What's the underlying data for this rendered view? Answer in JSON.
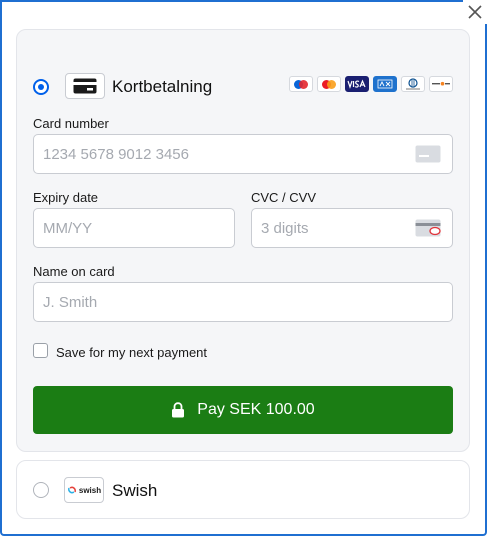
{
  "dialog": {
    "close_icon": "close-icon"
  },
  "card_method": {
    "title": "Kortbetalning",
    "selected": true,
    "icon": "credit-card-icon",
    "brands": [
      "Maestro",
      "Mastercard",
      "VISA",
      "American Express",
      "Diners Club",
      "Discover"
    ]
  },
  "form": {
    "card_number": {
      "label": "Card number",
      "placeholder": "1234 5678 9012 3456"
    },
    "expiry": {
      "label": "Expiry date",
      "placeholder": "MM/YY"
    },
    "cvc": {
      "label": "CVC / CVV",
      "placeholder": "3 digits"
    },
    "name": {
      "label": "Name on card",
      "placeholder": "J. Smith"
    },
    "save": {
      "label": "Save for my next payment",
      "checked": false
    },
    "pay_button": {
      "label": "Pay SEK 100.00",
      "icon": "lock-icon"
    }
  },
  "swish_method": {
    "title": "Swish",
    "selected": false,
    "logo_text": "swish"
  },
  "colors": {
    "accent": "#0060ea",
    "pay_button": "#1b7d14",
    "frame": "#1f6fd1"
  }
}
